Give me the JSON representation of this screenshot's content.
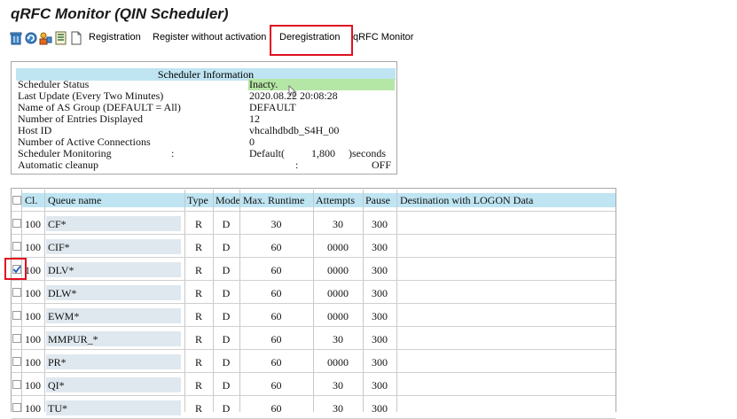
{
  "window": {
    "title": "qRFC Monitor (QIN Scheduler)"
  },
  "toolbar": {
    "icons": [
      "trash-icon",
      "refresh-icon",
      "worker-icon",
      "list-icon",
      "document-icon"
    ],
    "buttons": [
      {
        "label": "Registration"
      },
      {
        "label": "Register without activation"
      },
      {
        "label": "Deregistration"
      },
      {
        "label": "qRFC Monitor"
      }
    ]
  },
  "scheduler_info": {
    "heading": "Scheduler Information",
    "status_label": "Scheduler Status",
    "status_value": "Inacty.",
    "last_update_label": "Last Update (Every Two Minutes)",
    "last_update_value": "2020.08.22 20:08:28",
    "as_group_label": "Name of AS Group (DEFAULT = All)",
    "as_group_value": "DEFAULT",
    "entries_label": "Number of Entries Displayed",
    "entries_value": "12",
    "host_label": "Host ID",
    "host_value": "vhcalhdbdb_S4H_00",
    "connections_label": "Number of Active Connections",
    "connections_value": "0",
    "monitoring_label": "Scheduler Monitoring",
    "monitoring_colon": ":",
    "monitoring_value": "Default(",
    "monitoring_number": "1,800",
    "monitoring_unit": ")seconds",
    "cleanup_label": "Automatic cleanup",
    "cleanup_colon": ":",
    "cleanup_value": "OFF"
  },
  "queue_table": {
    "columns": [
      "Cl.",
      "Queue name",
      "Type",
      "Mode",
      "Max. Runtime",
      "Attempts",
      "Pause",
      "Destination with LOGON Data"
    ],
    "rows": [
      {
        "client": "100",
        "queue": "CF*",
        "type": "R",
        "mode": "D",
        "runtime": "30",
        "attempts": "30",
        "pause": "300",
        "checked": false
      },
      {
        "client": "100",
        "queue": "CIF*",
        "type": "R",
        "mode": "D",
        "runtime": "60",
        "attempts": "0000",
        "pause": "300",
        "checked": false
      },
      {
        "client": "100",
        "queue": "DLV*",
        "type": "R",
        "mode": "D",
        "runtime": "60",
        "attempts": "0000",
        "pause": "300",
        "checked": true
      },
      {
        "client": "100",
        "queue": "DLW*",
        "type": "R",
        "mode": "D",
        "runtime": "60",
        "attempts": "0000",
        "pause": "300",
        "checked": false
      },
      {
        "client": "100",
        "queue": "EWM*",
        "type": "R",
        "mode": "D",
        "runtime": "60",
        "attempts": "0000",
        "pause": "300",
        "checked": false
      },
      {
        "client": "100",
        "queue": "MMPUR_*",
        "type": "R",
        "mode": "D",
        "runtime": "60",
        "attempts": "30",
        "pause": "300",
        "checked": false
      },
      {
        "client": "100",
        "queue": "PR*",
        "type": "R",
        "mode": "D",
        "runtime": "60",
        "attempts": "0000",
        "pause": "300",
        "checked": false
      },
      {
        "client": "100",
        "queue": "QI*",
        "type": "R",
        "mode": "D",
        "runtime": "60",
        "attempts": "30",
        "pause": "300",
        "checked": false
      },
      {
        "client": "100",
        "queue": "TU*",
        "type": "R",
        "mode": "D",
        "runtime": "60",
        "attempts": "30",
        "pause": "300",
        "checked": false
      }
    ]
  },
  "colors": {
    "header_bg": "#bfe4f2",
    "status_bg": "#b4e6a5",
    "highlight": "#e01020",
    "check": "#1a5fb4"
  }
}
